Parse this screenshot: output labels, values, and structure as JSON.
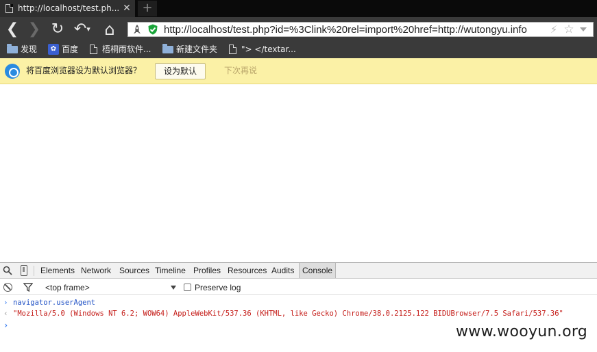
{
  "tab": {
    "title": "http://localhost/test.ph...",
    "close_glyph": "✕",
    "new_tab_glyph": "+"
  },
  "toolbar": {
    "back_glyph": "❮",
    "forward_glyph": "❯",
    "reload_glyph": "↻",
    "undo_glyph": "↶",
    "undo_drop_glyph": "▾",
    "home_glyph": "⌂",
    "url": "http://localhost/test.php?id=%3Clink%20rel=import%20href=http://wutongyu.info",
    "bolt_glyph": "⚡",
    "star_glyph": "☆"
  },
  "bookmarks": [
    {
      "label": "发现",
      "icon": "folder-icon"
    },
    {
      "label": "百度",
      "icon": "baidu-paw-icon"
    },
    {
      "label": "梧桐雨软件...",
      "icon": "page-icon"
    },
    {
      "label": "新建文件夹",
      "icon": "folder-icon"
    },
    {
      "label": "\"> </textar...",
      "icon": "page-icon"
    }
  ],
  "infobar": {
    "message": "将百度浏览器设为默认浏览器？",
    "set_default_label": "设为默认",
    "later_label": "下次再说"
  },
  "devtools": {
    "tabs": [
      "Elements",
      "Network",
      "Sources",
      "Timeline",
      "Profiles",
      "Resources",
      "Audits",
      "Console"
    ],
    "active_tab": "Console",
    "frame_select": "<top frame>",
    "preserve_log_label": "Preserve log",
    "preserve_log_checked": false,
    "console": {
      "command": "navigator.userAgent",
      "result": "\"Mozilla/5.0 (Windows NT 6.2; WOW64) AppleWebKit/537.36 (KHTML, like Gecko) Chrome/38.0.2125.122 BIDUBrowser/7.5 Safari/537.36\"",
      "prompt_glyph": "›",
      "result_glyph": "‹"
    }
  },
  "watermark": "www.wooyun.org",
  "colors": {
    "infobar_bg": "#fbf1a6",
    "toolbar_bg": "#3a3a3a",
    "console_result": "#c41a16",
    "console_command": "#1d4fc4",
    "secure_shield": "#1aa53a"
  }
}
